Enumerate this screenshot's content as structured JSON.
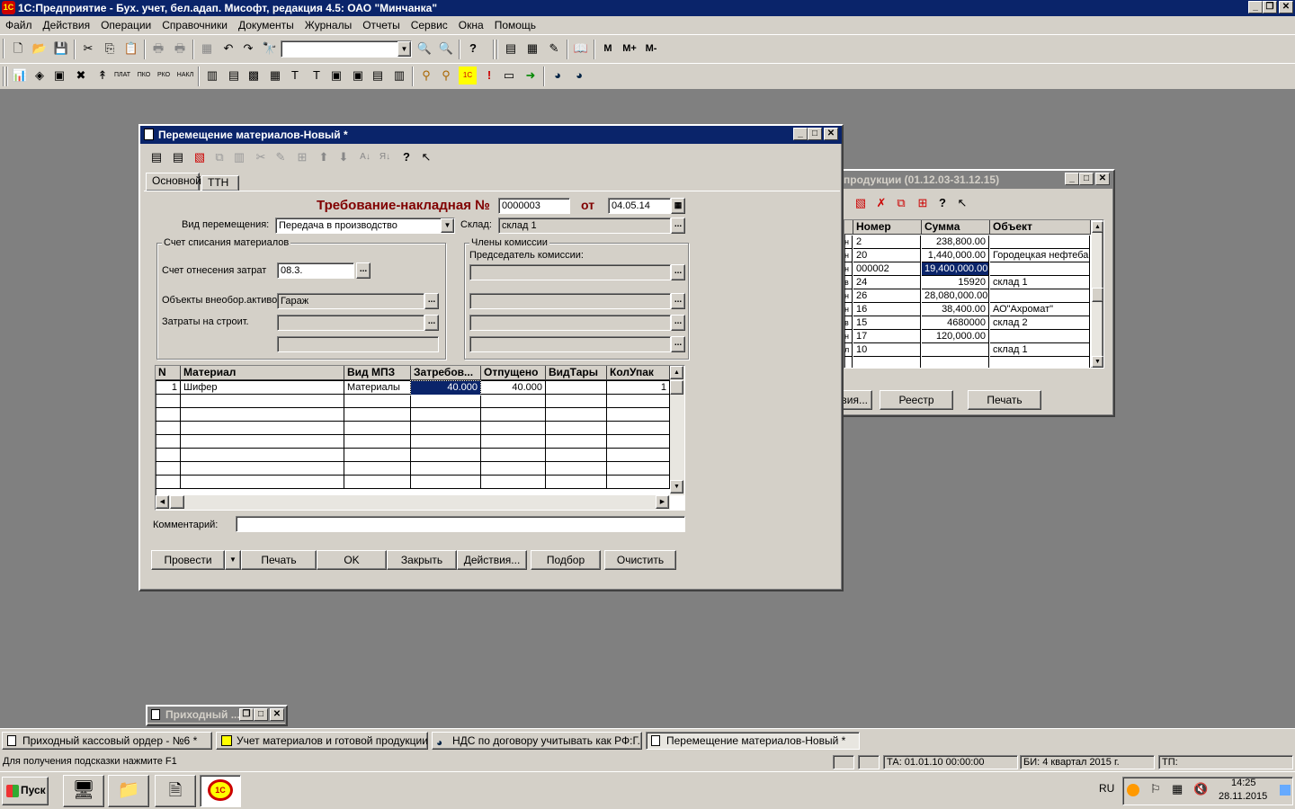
{
  "app": {
    "title": "1С:Предприятие - Бух. учет, бел.адап. Мисофт, редакция 4.5: ОАО \"Минчанка\"",
    "menu": [
      "Файл",
      "Действия",
      "Операции",
      "Справочники",
      "Документы",
      "Журналы",
      "Отчеты",
      "Сервис",
      "Окна",
      "Помощь"
    ],
    "toolbar_right": [
      "M",
      "M+",
      "M-"
    ]
  },
  "dialog": {
    "title": "Перемещение материалов-Новый *",
    "tabs": [
      "Основной",
      "ТТН"
    ],
    "heading": "Требование-накладная №",
    "doc_number": "0000003",
    "from_label": "от",
    "doc_date": "04.05.14",
    "move_type_label": "Вид перемещения:",
    "move_type_value": "Передача в производство",
    "warehouse_label": "Склад:",
    "warehouse_value": "склад 1",
    "group_writeoff": "Счет списания материалов",
    "cost_account_label": "Счет отнесения затрат",
    "cost_account_value": "08.3.",
    "fixed_assets_label": "Объекты внеобор.активов",
    "fixed_assets_value": "Гараж",
    "construction_label": "Затраты на строит.",
    "construction_value": "",
    "group_commission": "Члены комиссии",
    "chairman_label": "Председатель комиссии:",
    "table": {
      "columns": [
        "N",
        "Материал",
        "Вид МПЗ",
        "Затребов...",
        "Отпущено",
        "ВидТары",
        "КолУпак"
      ],
      "rows": [
        {
          "n": "1",
          "material": "Шифер",
          "kind": "Материалы",
          "requested": "40.000",
          "released": "40.000",
          "tare": "",
          "packs": "1"
        }
      ]
    },
    "comment_label": "Комментарий:",
    "comment_value": "",
    "buttons": {
      "post": "Провести",
      "print": "Печать",
      "ok": "OK",
      "close": "Закрыть",
      "actions": "Действия...",
      "select": "Подбор",
      "clear": "Очистить"
    }
  },
  "journal": {
    "title": "продукции (01.12.03-31.12.15)",
    "columns": [
      "Номер",
      "Сумма",
      "Объект"
    ],
    "rows": [
      {
        "mark": "н",
        "number": "2",
        "sum": "238,800.00",
        "object": ""
      },
      {
        "mark": "н",
        "number": "20",
        "sum": "1,440,000.00",
        "object": "Городецкая нефтеба"
      },
      {
        "mark": "н",
        "number": "000002",
        "sum": "19,400,000.00",
        "object": ""
      },
      {
        "mark": "в",
        "number": "24",
        "sum": "15920",
        "object": "склад 1"
      },
      {
        "mark": "н",
        "number": "26",
        "sum": "28,080,000.00",
        "object": ""
      },
      {
        "mark": "н",
        "number": "16",
        "sum": "38,400.00",
        "object": "АО\"Ахромат\""
      },
      {
        "mark": "в",
        "number": "15",
        "sum": "4680000",
        "object": "склад 2"
      },
      {
        "mark": "н",
        "number": "17",
        "sum": "120,000.00",
        "object": ""
      },
      {
        "mark": "л",
        "number": "10",
        "sum": "",
        "object": "склад 1"
      }
    ],
    "buttons": {
      "actions": "вия...",
      "registry": "Реестр",
      "print": "Печать"
    }
  },
  "minimized_window": {
    "title": "Приходный ..."
  },
  "taskbar_windows": [
    "Приходный кассовый ордер - №6 *",
    "Учет материалов и готовой продукции ...",
    "НДС по договору учитывать как РФ:Г...",
    "Перемещение материалов-Новый *"
  ],
  "status": {
    "hint": "Для получения подсказки нажмите F1",
    "ta": "ТА: 01.01.10  00:00:00",
    "bi": "БИ: 4 квартал 2015 г.",
    "tp": "ТП:"
  },
  "os_taskbar": {
    "start": "Пуск",
    "lang": "RU",
    "time": "14:25",
    "date": "28.11.2015"
  },
  "colors": {
    "titlebar": "#0a246a",
    "desktop": "#808080",
    "face": "#d4d0c8",
    "heading": "#800000",
    "selection": "#0a246a"
  }
}
